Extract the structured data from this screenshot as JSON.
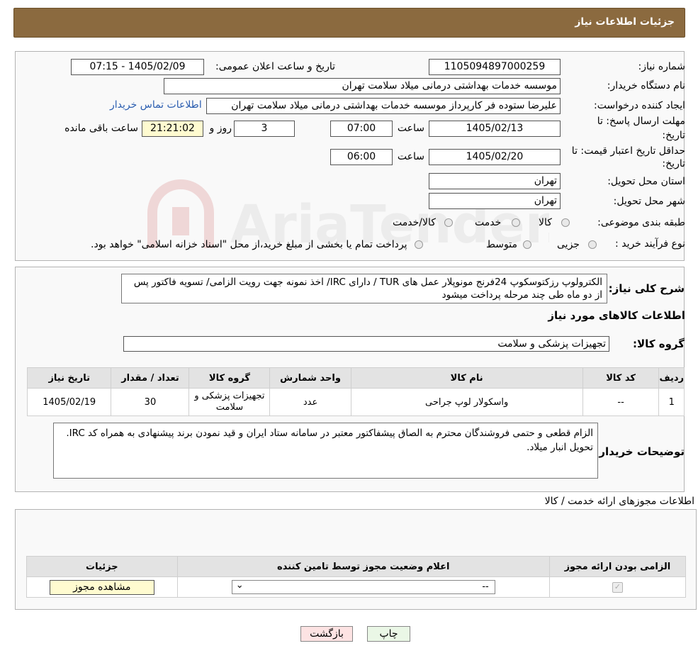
{
  "header": {
    "title": "جزئیات اطلاعات نیاز"
  },
  "fields": {
    "need_number_label": "شماره نیاز:",
    "need_number": "1105094897000259",
    "announce_label": "تاریخ و ساعت اعلان عمومی:",
    "announce_value": "1405/02/09 - 07:15",
    "buyer_org_label": "نام دستگاه خریدار:",
    "buyer_org": "موسسه خدمات بهداشتی درمانی میلاد سلامت تهران",
    "creator_label": "ایجاد کننده درخواست:",
    "creator": "علیرضا ستوده فر کارپرداز موسسه خدمات بهداشتی درمانی میلاد سلامت تهران",
    "contact_link": "اطلاعات تماس خریدار",
    "deadline_label_1": "مهلت ارسال پاسخ: تا",
    "deadline_label_2": "تاریخ:",
    "deadline_date": "1405/02/13",
    "time_label": "ساعت",
    "deadline_time": "07:00",
    "days_value": "3",
    "days_label": "روز و",
    "remaining_time": "21:21:02",
    "remaining_label": "ساعت باقی مانده",
    "validity_label_1": "حداقل تاریخ اعتبار قیمت: تا",
    "validity_label_2": "تاریخ:",
    "validity_date": "1405/02/20",
    "validity_time": "06:00",
    "province_label": "استان محل تحویل:",
    "province": "تهران",
    "city_label": "شهر محل تحویل:",
    "city": "تهران",
    "category_label": "طبقه بندی موضوعی:",
    "category_options": [
      "کالا",
      "خدمت",
      "کالا/خدمت"
    ],
    "process_label": "نوع فرآیند خرید :",
    "process_options": [
      "جزیی",
      "متوسط"
    ],
    "process_note": "پرداخت تمام یا بخشی از مبلغ خرید،از محل \"اسناد خزانه اسلامی\" خواهد بود."
  },
  "description": {
    "label": "شرح کلی نیاز:",
    "text": "الکترولوپ رزکتوسکوپ 24فرنج مونوپلار  عمل های TUR / دارای IRC/ اخذ نمونه جهت رویت الزامی/ تسویه فاکتور پس از دو ماه طی چند مرحله پرداخت میشود"
  },
  "goods": {
    "section_title": "اطلاعات کالاهای مورد نیاز",
    "group_label": "گروه کالا:",
    "group_value": "تجهیزات پزشکی و سلامت",
    "columns": [
      "ردیف",
      "کد کالا",
      "نام کالا",
      "واحد شمارش",
      "گروه کالا",
      "تعداد / مقدار",
      "تاریخ نیاز"
    ],
    "rows": [
      [
        "1",
        "--",
        "واسکولار لوپ جراحی",
        "عدد",
        "تجهیزات پزشکی و سلامت",
        "30",
        "1405/02/19"
      ]
    ]
  },
  "buyer_notes": {
    "label": "توضیحات خریدار:",
    "text": "الزام قطعی و حتمی فروشندگان محترم به الصاق پیشفاکتور معتبر در سامانه ستاد ایران و قید نمودن برند پیشنهادی به همراه کد IRC. تحویل انبار میلاد."
  },
  "licenses": {
    "section_title": "اطلاعات مجوزهای ارائه خدمت / کالا",
    "columns": [
      "الزامی بودن ارائه مجوز",
      "اعلام وضعیت مجوز توسط تامین کننده",
      "جزئیات"
    ],
    "select_value": "--",
    "view_button": "مشاهده مجوز"
  },
  "buttons": {
    "print": "چاپ",
    "back": "بازگشت"
  },
  "colors": {
    "header": "#8b6a3f",
    "link": "#2a5db0",
    "remaining_bg": "#fffbd0",
    "back_btn_bg": "#fde3e3",
    "print_btn_bg": "#eaf7e6"
  }
}
